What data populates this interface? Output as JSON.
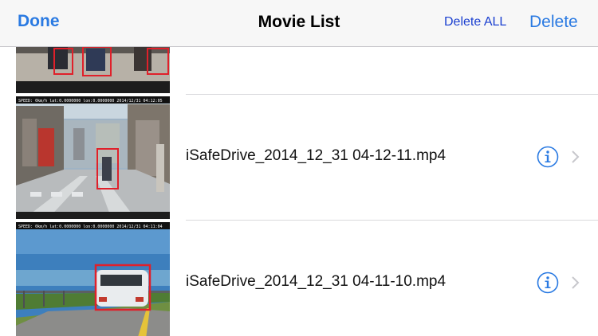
{
  "navbar": {
    "done_label": "Done",
    "title": "Movie List",
    "delete_all_label": "Delete ALL",
    "delete_label": "Delete"
  },
  "rows": [
    {
      "filename": "",
      "overlay": ""
    },
    {
      "filename": "iSafeDrive_2014_12_31 04-12-11.mp4",
      "overlay": "SPEED:  0km/h  lat:0.0000000  lon:0.0000000  2014/12/31 04:12:05"
    },
    {
      "filename": "iSafeDrive_2014_12_31 04-11-10.mp4",
      "overlay": "SPEED:  0km/h  lat:0.0000000  lon:0.0000000  2014/12/31 04:11:04"
    }
  ],
  "icons": {
    "info": "info-circle-icon",
    "disclosure": "chevron-right-icon"
  },
  "colors": {
    "accent": "#2a7ae2",
    "delete_all": "#1a3fd0",
    "detection_box": "#e0202a"
  }
}
